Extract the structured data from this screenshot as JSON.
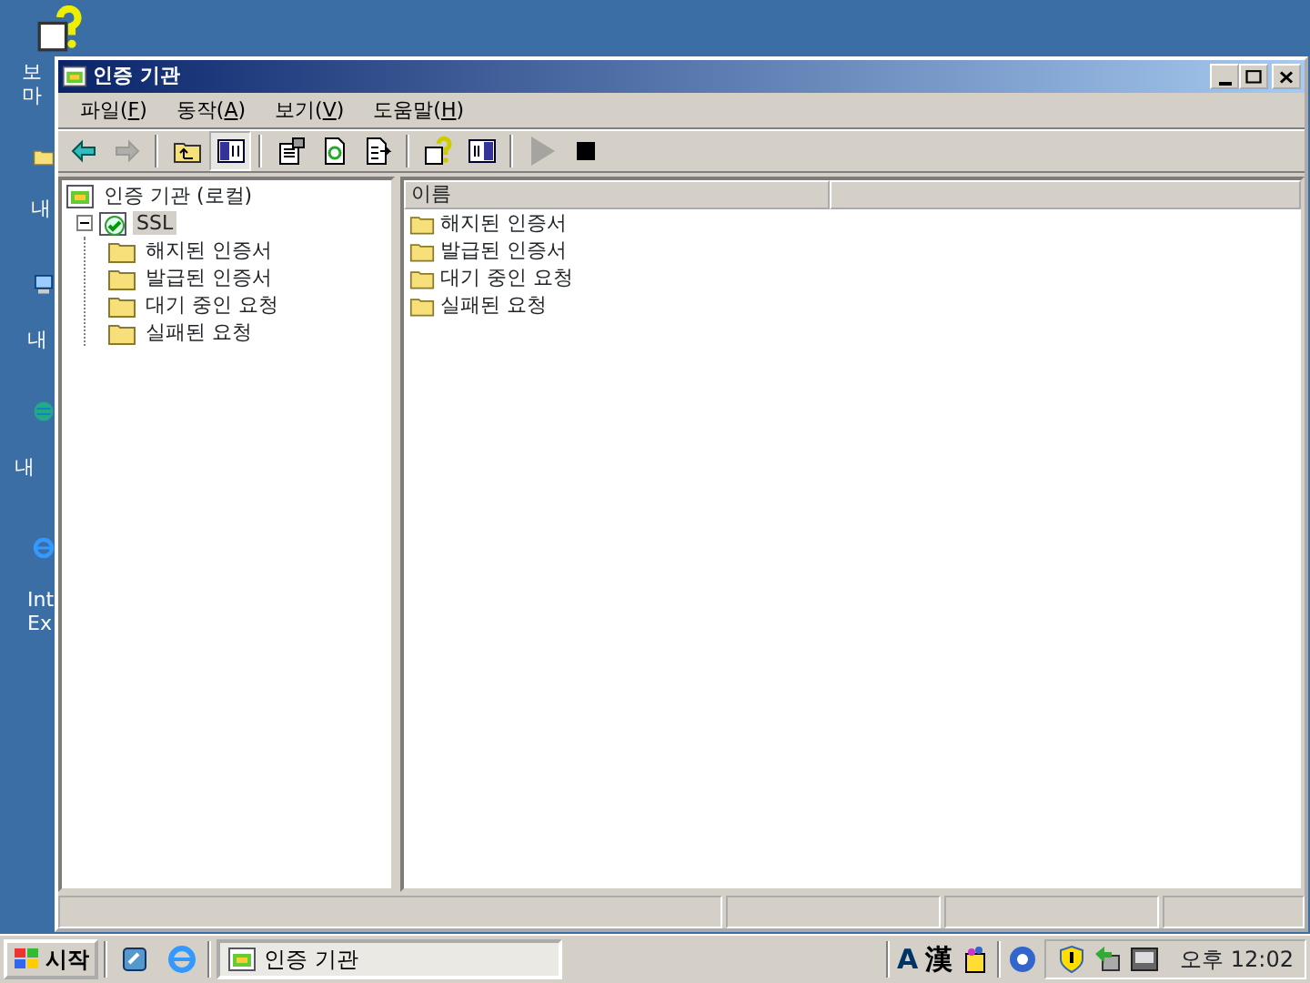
{
  "desktop_icons": [
    {
      "label_lines": [
        "보",
        "마"
      ]
    },
    {
      "label_lines": [
        "내"
      ]
    },
    {
      "label_lines": [
        "내"
      ]
    },
    {
      "label_lines": [
        "내"
      ]
    },
    {
      "label_lines": [
        "Int",
        "Ex"
      ]
    }
  ],
  "window": {
    "title": "인증 기관"
  },
  "menu": [
    {
      "before": "파일(",
      "key": "F",
      "after": ")"
    },
    {
      "before": "동작(",
      "key": "A",
      "after": ")"
    },
    {
      "before": "보기(",
      "key": "V",
      "after": ")"
    },
    {
      "before": "도움말(",
      "key": "H",
      "after": ")"
    }
  ],
  "toolbar": [
    {
      "kind": "button",
      "pressed": false,
      "disabled": false
    },
    {
      "kind": "button",
      "pressed": false,
      "disabled": true
    },
    {
      "kind": "separator"
    },
    {
      "kind": "button",
      "pressed": false,
      "disabled": false
    },
    {
      "kind": "button",
      "pressed": true,
      "disabled": false
    },
    {
      "kind": "separator"
    },
    {
      "kind": "button",
      "pressed": false,
      "disabled": false
    },
    {
      "kind": "button",
      "pressed": false,
      "disabled": false
    },
    {
      "kind": "button",
      "pressed": false,
      "disabled": false
    },
    {
      "kind": "separator"
    },
    {
      "kind": "button",
      "pressed": false,
      "disabled": false
    },
    {
      "kind": "button",
      "pressed": false,
      "disabled": false
    },
    {
      "kind": "separator"
    },
    {
      "kind": "button",
      "pressed": false,
      "disabled": true
    },
    {
      "kind": "button",
      "pressed": false,
      "disabled": false
    }
  ],
  "tree": [
    {
      "label": "인증 기관 (로컬)",
      "selected": false,
      "children": [
        {
          "label": "SSL",
          "selected": true,
          "expanded": true,
          "children": [
            {
              "label": "해지된 인증서",
              "selected": false
            },
            {
              "label": "발급된 인증서",
              "selected": false
            },
            {
              "label": "대기 중인 요청",
              "selected": false
            },
            {
              "label": "실패된 요청",
              "selected": false
            }
          ]
        }
      ]
    }
  ],
  "list": {
    "columns": [
      "이름"
    ],
    "items": [
      {
        "label": "해지된 인증서"
      },
      {
        "label": "발급된 인증서"
      },
      {
        "label": "대기 중인 요청"
      },
      {
        "label": "실패된 요청"
      }
    ]
  },
  "taskbar": {
    "start": "시작",
    "tasks": [
      {
        "label": "인증 기관",
        "selected": true
      }
    ],
    "tray_text": [
      "A",
      "漢"
    ],
    "clock": "오후 12:02"
  }
}
